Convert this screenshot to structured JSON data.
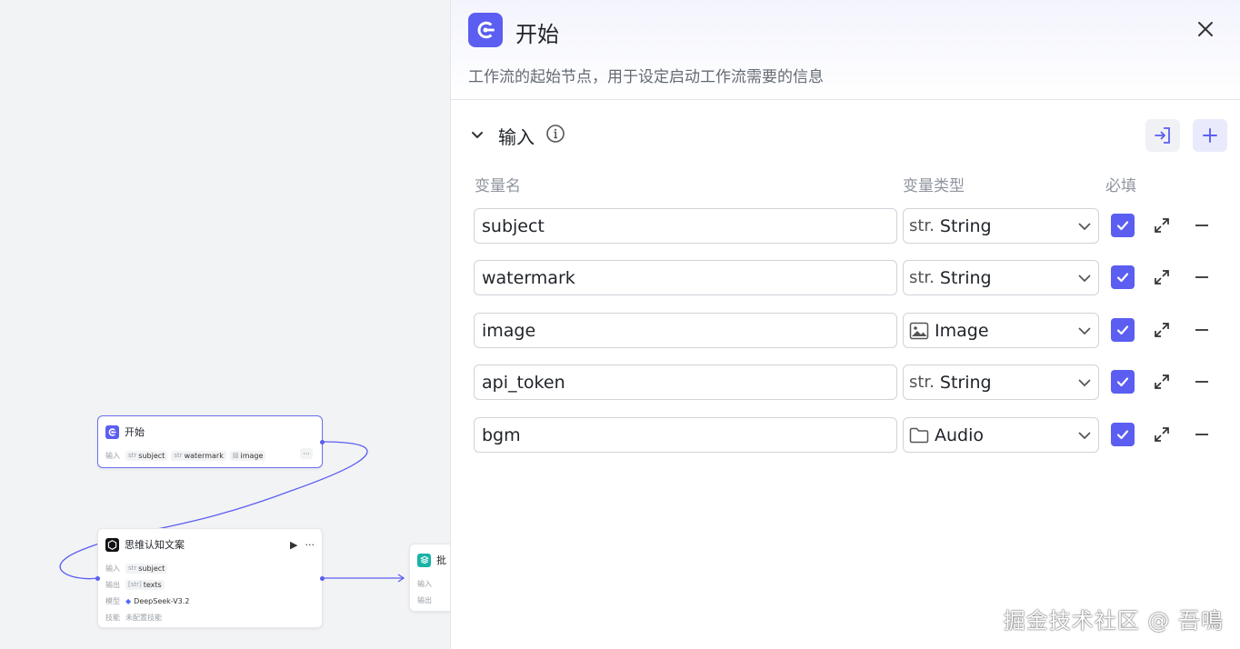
{
  "canvas": {
    "start_node": {
      "title": "开始",
      "input_label": "输入",
      "tags": [
        {
          "type": "str",
          "name": "subject"
        },
        {
          "type": "str",
          "name": "watermark"
        },
        {
          "type": "img",
          "name": "image"
        }
      ],
      "more": "···"
    },
    "llm_node": {
      "title": "思维认知文案",
      "run_icon": "▶",
      "menu_icon": "···",
      "input_label": "输入",
      "input_tag": {
        "type": "str",
        "name": "subject"
      },
      "output_label": "输出",
      "output_tag": {
        "type": "[str]",
        "name": "texts"
      },
      "model_label": "模型",
      "model_name": "DeepSeek-V3.2",
      "skill_label": "技能",
      "skill_value": "未配置技能"
    },
    "batch_node": {
      "title": "批",
      "input_label": "输入",
      "output_label": "输出"
    }
  },
  "panel": {
    "title": "开始",
    "description": "工作流的起始节点，用于设定启动工作流需要的信息",
    "section_title": "输入",
    "columns": {
      "name": "变量名",
      "type": "变量类型",
      "required": "必填"
    },
    "variables": [
      {
        "name": "subject",
        "type_prefix": "str.",
        "type": "String",
        "icon": "str-icon",
        "required": true
      },
      {
        "name": "watermark",
        "type_prefix": "str.",
        "type": "String",
        "icon": "str-icon",
        "required": true
      },
      {
        "name": "image",
        "type_prefix": "",
        "type": "Image",
        "icon": "image-icon",
        "required": true
      },
      {
        "name": "api_token",
        "type_prefix": "str.",
        "type": "String",
        "icon": "str-icon",
        "required": true
      },
      {
        "name": "bgm",
        "type_prefix": "",
        "type": "Audio",
        "icon": "folder-icon",
        "required": true
      }
    ]
  },
  "watermark": "掘金技术社区 @ 吾鳴",
  "colors": {
    "accent": "#5b5ef0",
    "teal": "#19b3a6"
  }
}
